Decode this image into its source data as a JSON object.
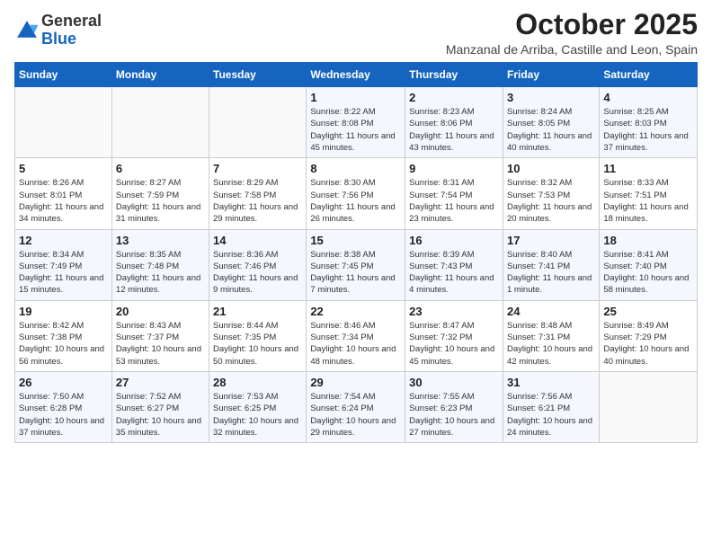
{
  "logo": {
    "general": "General",
    "blue": "Blue"
  },
  "title": "October 2025",
  "subtitle": "Manzanal de Arriba, Castille and Leon, Spain",
  "weekdays": [
    "Sunday",
    "Monday",
    "Tuesday",
    "Wednesday",
    "Thursday",
    "Friday",
    "Saturday"
  ],
  "weeks": [
    [
      {
        "day": "",
        "info": ""
      },
      {
        "day": "",
        "info": ""
      },
      {
        "day": "",
        "info": ""
      },
      {
        "day": "1",
        "info": "Sunrise: 8:22 AM\nSunset: 8:08 PM\nDaylight: 11 hours and 45 minutes."
      },
      {
        "day": "2",
        "info": "Sunrise: 8:23 AM\nSunset: 8:06 PM\nDaylight: 11 hours and 43 minutes."
      },
      {
        "day": "3",
        "info": "Sunrise: 8:24 AM\nSunset: 8:05 PM\nDaylight: 11 hours and 40 minutes."
      },
      {
        "day": "4",
        "info": "Sunrise: 8:25 AM\nSunset: 8:03 PM\nDaylight: 11 hours and 37 minutes."
      }
    ],
    [
      {
        "day": "5",
        "info": "Sunrise: 8:26 AM\nSunset: 8:01 PM\nDaylight: 11 hours and 34 minutes."
      },
      {
        "day": "6",
        "info": "Sunrise: 8:27 AM\nSunset: 7:59 PM\nDaylight: 11 hours and 31 minutes."
      },
      {
        "day": "7",
        "info": "Sunrise: 8:29 AM\nSunset: 7:58 PM\nDaylight: 11 hours and 29 minutes."
      },
      {
        "day": "8",
        "info": "Sunrise: 8:30 AM\nSunset: 7:56 PM\nDaylight: 11 hours and 26 minutes."
      },
      {
        "day": "9",
        "info": "Sunrise: 8:31 AM\nSunset: 7:54 PM\nDaylight: 11 hours and 23 minutes."
      },
      {
        "day": "10",
        "info": "Sunrise: 8:32 AM\nSunset: 7:53 PM\nDaylight: 11 hours and 20 minutes."
      },
      {
        "day": "11",
        "info": "Sunrise: 8:33 AM\nSunset: 7:51 PM\nDaylight: 11 hours and 18 minutes."
      }
    ],
    [
      {
        "day": "12",
        "info": "Sunrise: 8:34 AM\nSunset: 7:49 PM\nDaylight: 11 hours and 15 minutes."
      },
      {
        "day": "13",
        "info": "Sunrise: 8:35 AM\nSunset: 7:48 PM\nDaylight: 11 hours and 12 minutes."
      },
      {
        "day": "14",
        "info": "Sunrise: 8:36 AM\nSunset: 7:46 PM\nDaylight: 11 hours and 9 minutes."
      },
      {
        "day": "15",
        "info": "Sunrise: 8:38 AM\nSunset: 7:45 PM\nDaylight: 11 hours and 7 minutes."
      },
      {
        "day": "16",
        "info": "Sunrise: 8:39 AM\nSunset: 7:43 PM\nDaylight: 11 hours and 4 minutes."
      },
      {
        "day": "17",
        "info": "Sunrise: 8:40 AM\nSunset: 7:41 PM\nDaylight: 11 hours and 1 minute."
      },
      {
        "day": "18",
        "info": "Sunrise: 8:41 AM\nSunset: 7:40 PM\nDaylight: 10 hours and 58 minutes."
      }
    ],
    [
      {
        "day": "19",
        "info": "Sunrise: 8:42 AM\nSunset: 7:38 PM\nDaylight: 10 hours and 56 minutes."
      },
      {
        "day": "20",
        "info": "Sunrise: 8:43 AM\nSunset: 7:37 PM\nDaylight: 10 hours and 53 minutes."
      },
      {
        "day": "21",
        "info": "Sunrise: 8:44 AM\nSunset: 7:35 PM\nDaylight: 10 hours and 50 minutes."
      },
      {
        "day": "22",
        "info": "Sunrise: 8:46 AM\nSunset: 7:34 PM\nDaylight: 10 hours and 48 minutes."
      },
      {
        "day": "23",
        "info": "Sunrise: 8:47 AM\nSunset: 7:32 PM\nDaylight: 10 hours and 45 minutes."
      },
      {
        "day": "24",
        "info": "Sunrise: 8:48 AM\nSunset: 7:31 PM\nDaylight: 10 hours and 42 minutes."
      },
      {
        "day": "25",
        "info": "Sunrise: 8:49 AM\nSunset: 7:29 PM\nDaylight: 10 hours and 40 minutes."
      }
    ],
    [
      {
        "day": "26",
        "info": "Sunrise: 7:50 AM\nSunset: 6:28 PM\nDaylight: 10 hours and 37 minutes."
      },
      {
        "day": "27",
        "info": "Sunrise: 7:52 AM\nSunset: 6:27 PM\nDaylight: 10 hours and 35 minutes."
      },
      {
        "day": "28",
        "info": "Sunrise: 7:53 AM\nSunset: 6:25 PM\nDaylight: 10 hours and 32 minutes."
      },
      {
        "day": "29",
        "info": "Sunrise: 7:54 AM\nSunset: 6:24 PM\nDaylight: 10 hours and 29 minutes."
      },
      {
        "day": "30",
        "info": "Sunrise: 7:55 AM\nSunset: 6:23 PM\nDaylight: 10 hours and 27 minutes."
      },
      {
        "day": "31",
        "info": "Sunrise: 7:56 AM\nSunset: 6:21 PM\nDaylight: 10 hours and 24 minutes."
      },
      {
        "day": "",
        "info": ""
      }
    ]
  ]
}
